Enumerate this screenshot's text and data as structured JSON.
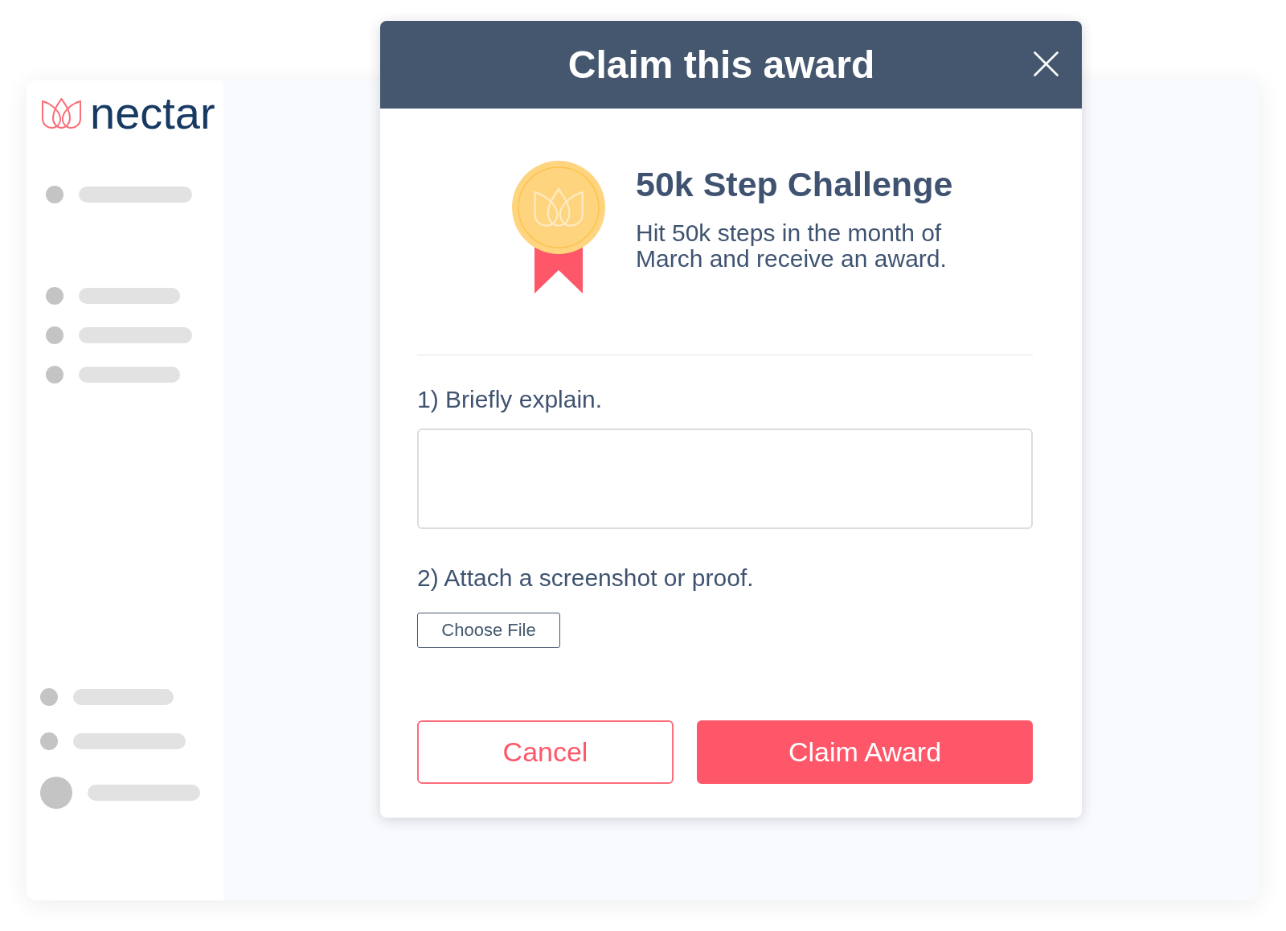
{
  "app": {
    "logo": "nectar"
  },
  "dialog": {
    "title": "Claim this award",
    "award": {
      "name": "50k Step Challenge",
      "description": "Hit 50k steps in the month of March and receive an award."
    },
    "questions": [
      {
        "kind": "textarea",
        "label": "1) Briefly explain."
      },
      {
        "kind": "file",
        "label": "2) Attach a screenshot or proof.",
        "button": "Choose File"
      }
    ],
    "buttons": [
      {
        "kind": "secondary",
        "label": "Cancel"
      },
      {
        "kind": "primary",
        "label": "Claim Award"
      }
    ]
  }
}
